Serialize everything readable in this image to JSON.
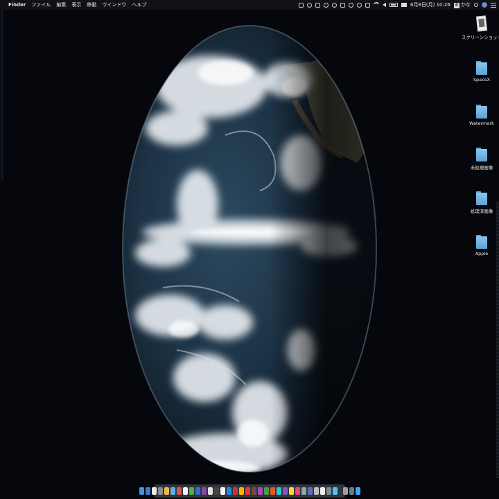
{
  "menubar": {
    "apple_glyph": "",
    "app_name": "Finder",
    "menus": [
      "ファイル",
      "編集",
      "表示",
      "移動",
      "ウインドウ",
      "ヘルプ"
    ],
    "clock": "6月8日(月) 10:26",
    "ime_label": "かな",
    "status_icons": [
      "menu-extra-icon",
      "info-icon",
      "phone-icon",
      "pie-icon",
      "cloud-icon",
      "dropbox-icon",
      "person-icon",
      "time-machine-icon",
      "bluetooth-icon",
      "wifi-icon",
      "volume-icon",
      "battery-icon",
      "flag-icon",
      "search-icon",
      "avatar-icon",
      "notification-list-icon"
    ]
  },
  "desktop_icons": [
    {
      "label": "スクリーンショット",
      "icon": "screenshot-file-icon"
    },
    {
      "label": "SpaceX",
      "icon": "folder-icon"
    },
    {
      "label": "Watermark",
      "icon": "folder-icon"
    },
    {
      "label": "未処理画像",
      "icon": "folder-icon"
    },
    {
      "label": "処理済画像",
      "icon": "folder-icon"
    },
    {
      "label": "Apple",
      "icon": "folder-icon"
    }
  ],
  "wallpaper": {
    "subject": "earth-satellite-image",
    "ocean_color": "#1d3346",
    "cloud_color": "#e9eef2",
    "background_color": "#05070d"
  },
  "dock": {
    "item_colors": [
      "#4a90d9",
      "#3d7bd8",
      "#e8e8e8",
      "#8c8c8c",
      "#f0b84a",
      "#5ab0e8",
      "#d9534f",
      "#f5f5f5",
      "#4caf50",
      "#2f6fd0",
      "#8e44ad",
      "#e0e0e0",
      "#444",
      "#f5f5f5",
      "#1e88e5",
      "#c0392b",
      "#ffb300",
      "#e53935",
      "#6d4c41",
      "#ab47bc",
      "#43a047",
      "#f4511e",
      "#26c6da",
      "#7e57c2",
      "#fdd835",
      "#ec407a",
      "#90a4ae",
      "#5c6bc0",
      "#bdbdbd",
      "#eeeeee",
      "#78909c",
      "#4fc3f7",
      "#9e9e9e",
      "#607d8b",
      "#42a5f5"
    ]
  }
}
